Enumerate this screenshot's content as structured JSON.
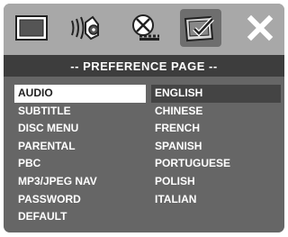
{
  "toolbar": {
    "icons": [
      {
        "name": "general-setup-icon"
      },
      {
        "name": "audio-setup-icon"
      },
      {
        "name": "video-setup-icon"
      },
      {
        "name": "preference-page-icon"
      },
      {
        "name": "exit-icon"
      }
    ]
  },
  "page_title": "-- PREFERENCE PAGE --",
  "menu": {
    "selected_index": 0,
    "items": [
      "AUDIO",
      "SUBTITLE",
      "DISC MENU",
      "PARENTAL",
      "PBC",
      "MP3/JPEG NAV",
      "PASSWORD",
      "DEFAULT"
    ]
  },
  "options": {
    "selected_index": 0,
    "items": [
      "ENGLISH",
      "CHINESE",
      "FRENCH",
      "SPANISH",
      "PORTUGUESE",
      "POLISH",
      "ITALIAN"
    ]
  },
  "colors": {
    "toolbar_bg": "#a8a8a8",
    "title_bg": "#3d3d3d",
    "content_bg": "#666666",
    "menu_highlight": "#ffffff",
    "option_highlight": "#444444"
  }
}
